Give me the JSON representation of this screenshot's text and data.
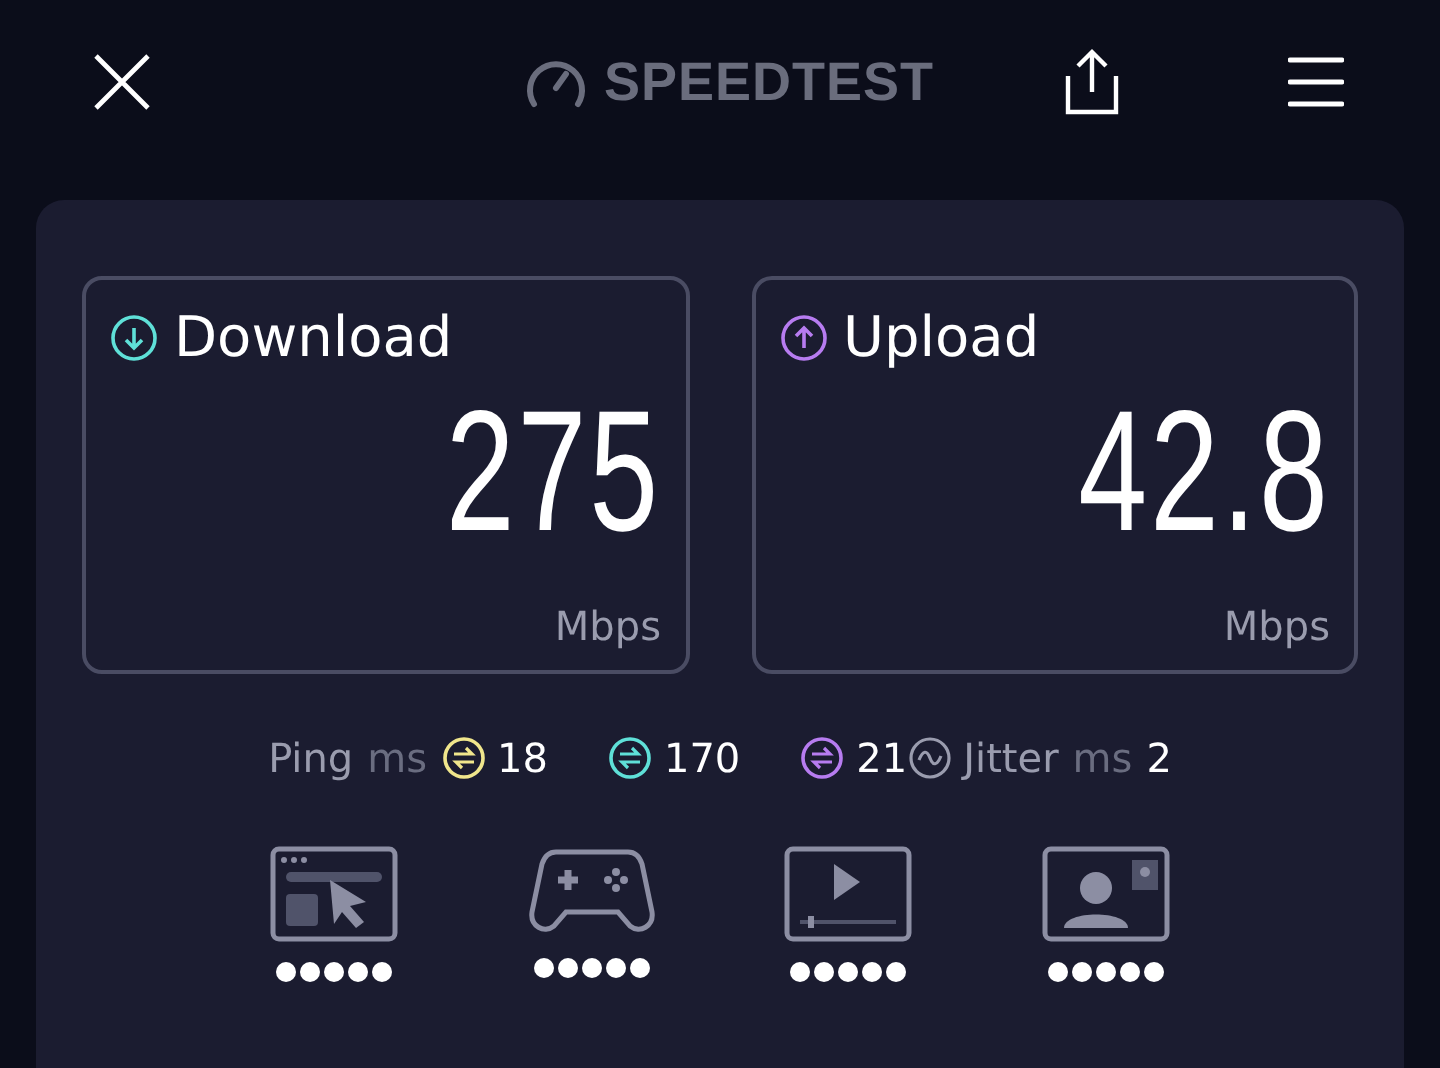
{
  "header": {
    "logo": "SPEEDTEST"
  },
  "results": [
    {
      "kind": "download",
      "label": "Download",
      "value": "275",
      "unit": "Mbps"
    },
    {
      "kind": "upload",
      "label": "Upload",
      "value": "42.8",
      "unit": "Mbps"
    }
  ],
  "ping": {
    "label": "Ping",
    "unit": "ms",
    "readings": [
      {
        "value": "18",
        "color": "#f0e68c"
      },
      {
        "value": "170",
        "color": "#5fe0d8"
      },
      {
        "value": "21",
        "color": "#b77cf0"
      }
    ]
  },
  "jitter": {
    "label": "Jitter",
    "unit": "ms",
    "value": "2"
  },
  "ratings": [
    {
      "kind": "browsing",
      "stars": 5
    },
    {
      "kind": "gaming",
      "stars": 5
    },
    {
      "kind": "streaming",
      "stars": 5
    },
    {
      "kind": "video_call",
      "stars": 5
    }
  ]
}
